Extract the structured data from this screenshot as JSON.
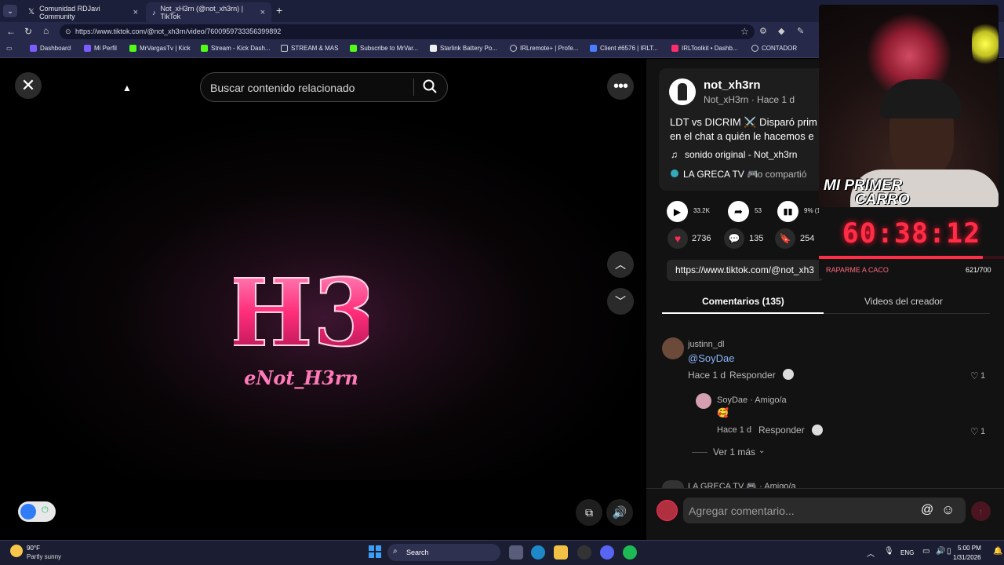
{
  "browser": {
    "tabs": [
      {
        "label": "Comunidad RDJavi Community",
        "icon": "x-logo-icon"
      },
      {
        "label": "Not_xH3rn (@not_xh3rn) | TikTok",
        "icon": "tiktok-icon"
      }
    ],
    "new_tab": "+",
    "url": "https://www.tiktok.com/@not_xh3rn/video/7600959733356399892",
    "bookmarks": [
      "Dashboard",
      "Mi Perfil",
      "MrVargasTv | Kick",
      "Stream - Kick Dash...",
      "STREAM & MAS",
      "Subscribe to MrVar...",
      "Starlink Battery Po...",
      "IRLremote+ | Profe...",
      "Client #6576 | IRLT...",
      "IRLToolkit • Dashb...",
      "CONTADOR"
    ]
  },
  "viewer": {
    "search_placeholder": "Buscar contenido relacionado",
    "logo_text": "H3",
    "logo_sub": "eNot_H3rn"
  },
  "post": {
    "username": "not_xh3rn",
    "meta": "Not_xH3rn · Hace 1 d",
    "caption_line1": "LDT vs DICRIM ⚔️ Disparó prim",
    "caption_line2": "en el chat a quién le hacemos e",
    "sound": "sonido original - Not_xh3rn",
    "shared_by": "LA GRECA TV 🎮",
    "shared_suffix": "lo compartió",
    "plays": "33.2K",
    "shares_small": "53",
    "stats_small": "9% (1",
    "likes": "2736",
    "comments": "135",
    "saves": "254",
    "link": "https://www.tiktok.com/@not_xh3"
  },
  "tabs": {
    "comments": "Comentarios (135)",
    "videos": "Videos del creador"
  },
  "comments": [
    {
      "user": "justinn_dl",
      "text": "@SoyDae",
      "time": "Hace 1 d",
      "reply": "Responder",
      "likes": "1"
    },
    {
      "user": "SoyDae · Amigo/a",
      "text": "🥰",
      "time": "Hace 1 d",
      "reply": "Responder",
      "likes": "1"
    }
  ],
  "more_replies": "Ver 1 más",
  "cut_user": "LA GRECA TV 🎮 · Amigo/a",
  "add_comment": "Agregar comentario...",
  "overlay": {
    "cam_title_1": "MI PRIMER",
    "cam_title_2": "CARRO",
    "timer": "60:38:12",
    "label": "RAPARME A CACO",
    "count": "621/700",
    "progress": 0.887
  },
  "taskbar": {
    "temp": "90°F",
    "weather": "Partly sunny",
    "search": "Search",
    "lang": "ENG",
    "time": "5:00 PM",
    "date": "1/31/2026"
  },
  "colors": {
    "accent": "#fe2c55",
    "timer": "#ff2d45",
    "link": "#8ab4f8"
  }
}
